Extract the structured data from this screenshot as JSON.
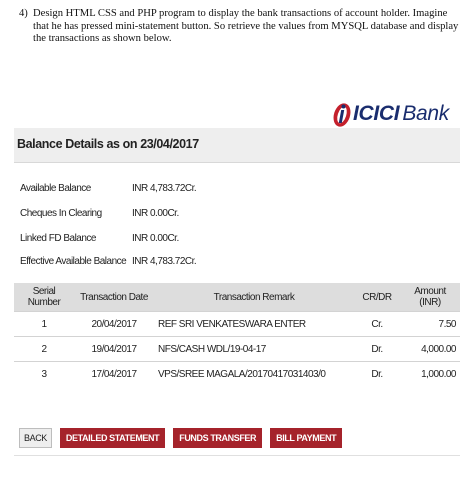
{
  "question": {
    "number": "4)",
    "text": "Design HTML CSS and PHP program to display the bank transactions of account holder. Imagine that he has pressed mini-statement button. So retrieve the values from MYSQL database and display the transactions as shown below."
  },
  "logo": {
    "name": "ICICI",
    "suffix": "Bank",
    "color": "#1a2d6e",
    "accent": "#c4202c"
  },
  "balance": {
    "title": "Balance Details as on 23/04/2017",
    "rows": [
      {
        "label": "Available Balance",
        "value": "INR 4,783.72Cr."
      },
      {
        "label": "Cheques In Clearing",
        "value": "INR 0.00Cr."
      },
      {
        "label": "Linked FD Balance",
        "value": "INR 0.00Cr."
      },
      {
        "label": "Effective Available Balance",
        "value": "INR 4,783.72Cr."
      }
    ]
  },
  "transactions": {
    "headers": [
      "Serial Number",
      "Transaction Date",
      "Transaction Remark",
      "CR/DR",
      "Amount (INR)"
    ],
    "rows": [
      {
        "serial": "1",
        "date": "20/04/2017",
        "remark": "REF SRI VENKATESWARA ENTER",
        "crdr": "Cr.",
        "amount": "7.50"
      },
      {
        "serial": "2",
        "date": "19/04/2017",
        "remark": "NFS/CASH WDL/19-04-17",
        "crdr": "Dr.",
        "amount": "4,000.00"
      },
      {
        "serial": "3",
        "date": "17/04/2017",
        "remark": "VPS/SREE MAGALA/20170417031403/0",
        "crdr": "Dr.",
        "amount": "1,000.00"
      }
    ]
  },
  "buttons": {
    "back": "BACK",
    "detailed": "DETAILED STATEMENT",
    "funds": "FUNDS TRANSFER",
    "bill": "BILL PAYMENT",
    "accent_color": "#a5232b"
  }
}
